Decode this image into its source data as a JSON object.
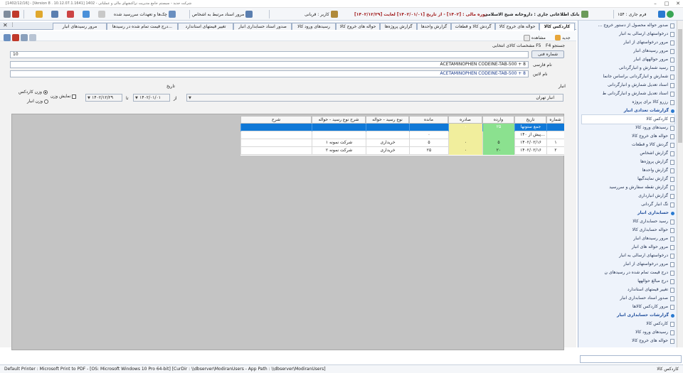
{
  "window": {
    "title": "[1402/12/16] - [Version 8 . 10.12.07.1.1641] 1402 - شرکت جدید - سیستم جامع مدیریت تراکنشهای مالی و عملیاتی",
    "controls": {
      "minimize": "–",
      "maximize": "□",
      "close": "✕"
    }
  },
  "toolbar": {
    "form_label": "فرم جاری :",
    "form_value": "۱۵۴",
    "db_info": "بانک اطلاعاتی جاری : داروخانه شیخ الاسلامی",
    "period": "دوره مالی : [۱۴۰۲] - از تاریخ [۱۴۰۲/۰۱/۰۱] لغایت [۱۴۰۲/۱۲/۲۹]",
    "user": "کاربر : قربانی",
    "linked_docs": "مرور اسناد مرتبط به اشخاص",
    "cheques": "چک‌ها و تعهدات سررسید شده"
  },
  "tabs": [
    {
      "label": "کاردکس کالا",
      "active": true
    },
    {
      "label": "حواله های خروج کالا",
      "active": false
    },
    {
      "label": "گردش کالا و قطعات",
      "active": false
    },
    {
      "label": "گزارش واحدها",
      "active": false
    },
    {
      "label": "گزارش پروژه‌ها",
      "active": false
    },
    {
      "label": "حواله های خروج کالا",
      "active": false
    },
    {
      "label": "رسیدهای ورود کالا",
      "active": false
    },
    {
      "label": "صدور اسناد حسابداری انبار",
      "active": false
    },
    {
      "label": "تغییر قیمتهای استاندارد",
      "active": false
    },
    {
      "label": "درج قیمت تمام شده در رسیدها...",
      "active": false
    },
    {
      "label": "مرور رسیدهای انبار",
      "active": false
    }
  ],
  "actions": {
    "new": "جدید",
    "view": "مشاهده"
  },
  "form": {
    "search_hint": "F4 جستجو",
    "search_key": "F5",
    "selected_specs": "مشخصات کالای انتخابی",
    "tech_no_button": "شماره فنی",
    "tech_no_value": "10",
    "persian_name_label": "نام فارسی",
    "persian_name_value": "ACETAMINOPHEN  CODEINE-TAB-500 + 8",
    "latin_name_label": "نام لاتین",
    "latin_name_value": "ACETAMINOPHEN  CODEINE-TAB-500 + 8",
    "warehouse_label": "انبار",
    "warehouse_value": "انبار تهران",
    "date_label": "تاریخ",
    "from_label": "از",
    "to_label": "تا",
    "date_from": "۱۴۰۲/۰۱/۰۱",
    "date_to": "۱۴۰۲/۱۲/۲۹",
    "show_weight": "نمایش وزن",
    "weight_cardex": "وزن کاردکس",
    "weight_warehouse": "وزن انبار"
  },
  "grid": {
    "columns": [
      "شماره",
      "تاریخ",
      "وارده",
      "صادره",
      "مانده",
      "نوع رسید - حواله",
      "شرح نوع رسید - حواله",
      "شرح"
    ],
    "rows": [
      {
        "cells": [
          "",
          "جمع ستونها",
          "۲۵",
          "۰",
          "",
          "",
          "",
          ""
        ],
        "selected": true
      },
      {
        "cells": [
          "",
          "پیش از ۱۴۰...",
          "",
          "",
          "۰",
          "",
          "",
          ""
        ],
        "selected": false
      },
      {
        "cells": [
          "۱",
          "۱۴۰۲/۰۲/۱۶",
          "۵",
          "۰",
          "۵",
          "خریداری",
          "شرکت نمونه ۱",
          ""
        ],
        "selected": false
      },
      {
        "cells": [
          "۲",
          "۱۴۰۲/۰۲/۱۶",
          "۲۰",
          "۰",
          "۲۵",
          "خریداری",
          "شرکت نمونه ۲",
          ""
        ],
        "selected": false
      }
    ]
  },
  "sidebar": {
    "items": [
      {
        "label": "صدور حواله محصول از دستور خروج ...",
        "type": "item"
      },
      {
        "label": "درخواستهای ارسالی به انبار",
        "type": "item"
      },
      {
        "label": "مرور درخواستهای از انبار",
        "type": "item"
      },
      {
        "label": "مرور رسیدهای انبار",
        "type": "item"
      },
      {
        "label": "مرور حوالههای انبار",
        "type": "item"
      },
      {
        "label": "رسید شمارش و انبارگردانی",
        "type": "item"
      },
      {
        "label": "شمارش و انبارگردانی براساس جانما",
        "type": "item"
      },
      {
        "label": "اسناد تعدیل شمارش و انبارگردانی",
        "type": "item"
      },
      {
        "label": "اسناد تعدیل شمارش و انبارگردانی ط",
        "type": "item"
      },
      {
        "label": "رزرو کالا برای پروژه",
        "type": "item"
      },
      {
        "label": "گزارشات تعدادی انبار",
        "type": "group"
      },
      {
        "label": "کاردکس کالا",
        "type": "item",
        "selected": true
      },
      {
        "label": "رسیدهای ورود کالا",
        "type": "item"
      },
      {
        "label": "حواله های خروج کالا",
        "type": "item"
      },
      {
        "label": "گردش کالا و قطعات",
        "type": "item"
      },
      {
        "label": "گزارش اشخاص",
        "type": "item"
      },
      {
        "label": "گزارش پروژه‌ها",
        "type": "item"
      },
      {
        "label": "گزارش واحدها",
        "type": "item"
      },
      {
        "label": "گزارش نمایندگیها",
        "type": "item"
      },
      {
        "label": "گزارش نقطه سفارش و سررسید",
        "type": "item"
      },
      {
        "label": "گزارش انبارداری",
        "type": "item"
      },
      {
        "label": "تگ انبار گردانی",
        "type": "item"
      },
      {
        "label": "حسابداری انبار",
        "type": "group"
      },
      {
        "label": "رسید حسابداری کالا",
        "type": "item"
      },
      {
        "label": "حواله حسابداری کالا",
        "type": "item"
      },
      {
        "label": "مرور رسیدهای انبار",
        "type": "item"
      },
      {
        "label": "مرور حواله های انبار",
        "type": "item"
      },
      {
        "label": "درخواستهای ارسالی به انبار",
        "type": "item"
      },
      {
        "label": "مرور درخواستهای از انبار",
        "type": "item"
      },
      {
        "label": "درج قیمت تمام شده در رسیدهای ن",
        "type": "item"
      },
      {
        "label": "درج مبالغ حوالهها",
        "type": "item"
      },
      {
        "label": "تغییر قیمتهای استاندارد",
        "type": "item"
      },
      {
        "label": "صدور اسناد حسابداری انبار",
        "type": "item"
      },
      {
        "label": "مرور کاردکس کالاها",
        "type": "item"
      },
      {
        "label": "گزارشات حسابداری انبار",
        "type": "group"
      },
      {
        "label": "کاردکس کالا",
        "type": "item"
      },
      {
        "label": "رسیدهای ورود کالا",
        "type": "item"
      },
      {
        "label": "حواله های خروج کالا",
        "type": "item"
      }
    ]
  },
  "statusbar": {
    "left": "Default Printer : Microsoft Print to PDF - [OS: Microsoft Windows 10 Pro 64-bit]  [CurDir : \\\\dbserver\\ModiranUsers - App Path : \\\\dbserver\\ModiranUsers]",
    "right": "کاردکس کالا"
  },
  "colors": {
    "selection": "#0f78d7",
    "incoming": "#8be18f",
    "outgoing": "#f1ee9d",
    "accent": "#2a7ad0"
  }
}
